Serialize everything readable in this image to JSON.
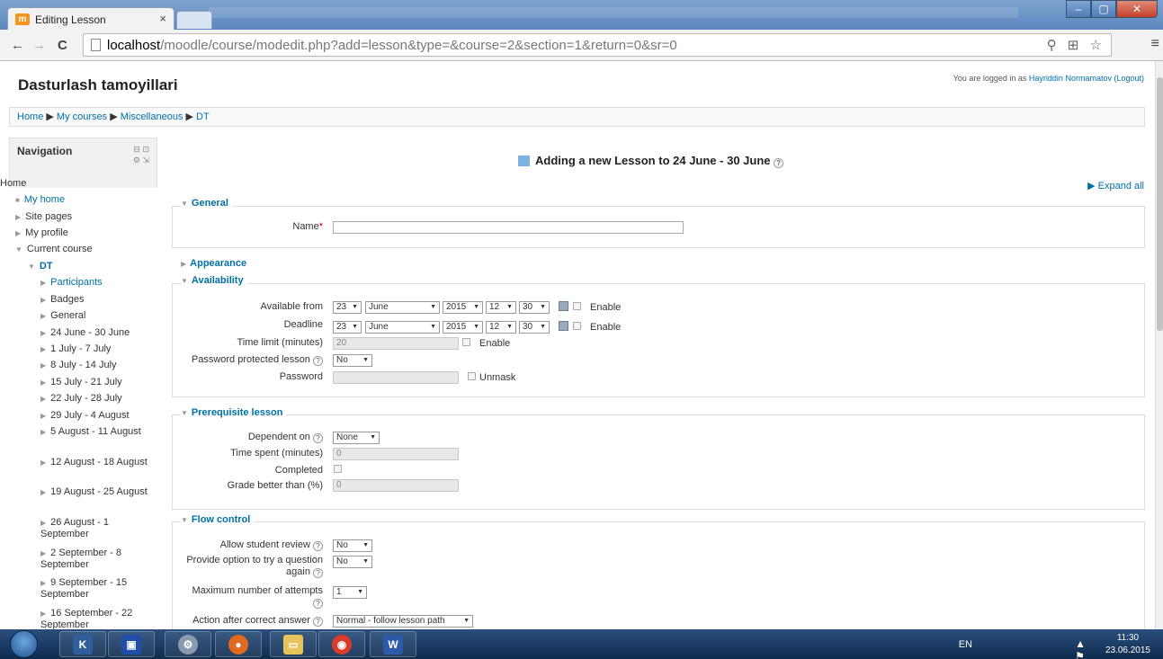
{
  "browser": {
    "tab_title": "Editing Lesson",
    "tab_favicon": "m",
    "url_host": "localhost",
    "url_rest": "/moodle/course/modedit.php?add=lesson&type=&course=2&section=1&return=0&sr=0"
  },
  "header": {
    "site_title": "Dasturlash tamoyillari",
    "logged_in_prefix": "You are logged in as ",
    "user_name": "Hayriddin Normamatov",
    "logout": "(Logout)"
  },
  "breadcrumb": [
    "Home",
    "My courses",
    "Miscellaneous",
    "DT"
  ],
  "navigation": {
    "title": "Navigation",
    "home": "Home",
    "items": [
      {
        "label": "My home"
      },
      {
        "label": "Site pages"
      },
      {
        "label": "My profile"
      },
      {
        "label": "Current course"
      },
      {
        "label": "DT"
      },
      {
        "label": "Participants"
      },
      {
        "label": "Badges"
      },
      {
        "label": "General"
      },
      {
        "label": "24 June - 30 June"
      },
      {
        "label": "1 July - 7 July"
      },
      {
        "label": "8 July - 14 July"
      },
      {
        "label": "15 July - 21 July"
      },
      {
        "label": "22 July - 28 July"
      },
      {
        "label": "29 July - 4 August"
      },
      {
        "label": "5 August - 11 August"
      },
      {
        "label": "12 August - 18 August"
      },
      {
        "label": "19 August - 25 August"
      },
      {
        "label": "26 August - 1 September"
      },
      {
        "label": "2 September - 8 September"
      },
      {
        "label": "9 September - 15 September"
      },
      {
        "label": "16 September - 22 September"
      }
    ]
  },
  "main": {
    "title": "Adding a new Lesson to 24 June - 30 June",
    "expand_all": "Expand all",
    "general": {
      "legend": "General",
      "name_label": "Name",
      "name_value": ""
    },
    "appearance": {
      "legend": "Appearance"
    },
    "availability": {
      "legend": "Availability",
      "available_from": "Available from",
      "deadline": "Deadline",
      "day": "23",
      "month": "June",
      "year": "2015",
      "hour": "12",
      "minute": "30",
      "enable": "Enable",
      "time_limit": "Time limit (minutes)",
      "time_limit_value": "20",
      "password_protected": "Password protected lesson",
      "password_protected_value": "No",
      "password": "Password",
      "unmask": "Unmask"
    },
    "prerequisite": {
      "legend": "Prerequisite lesson",
      "dependent_on": "Dependent on",
      "dependent_on_value": "None",
      "time_spent": "Time spent (minutes)",
      "time_spent_value": "0",
      "completed": "Completed",
      "grade_better": "Grade better than (%)",
      "grade_better_value": "0"
    },
    "flow": {
      "legend": "Flow control",
      "allow_review": "Allow student review",
      "allow_review_value": "No",
      "try_again_1": "Provide option to try a question",
      "try_again_2": "again",
      "try_again_value": "No",
      "max_attempts": "Maximum number of attempts",
      "max_attempts_value": "1",
      "action_after": "Action after correct answer",
      "action_after_value": "Normal - follow lesson path"
    }
  },
  "taskbar": {
    "lang": "EN",
    "time": "11:30",
    "date": "23.06.2015",
    "apps": [
      "kmp",
      "save",
      "settings",
      "firefox",
      "explorer",
      "chrome",
      "word"
    ]
  },
  "colors": {
    "link": "#0070a8",
    "required": "#cc0000"
  }
}
